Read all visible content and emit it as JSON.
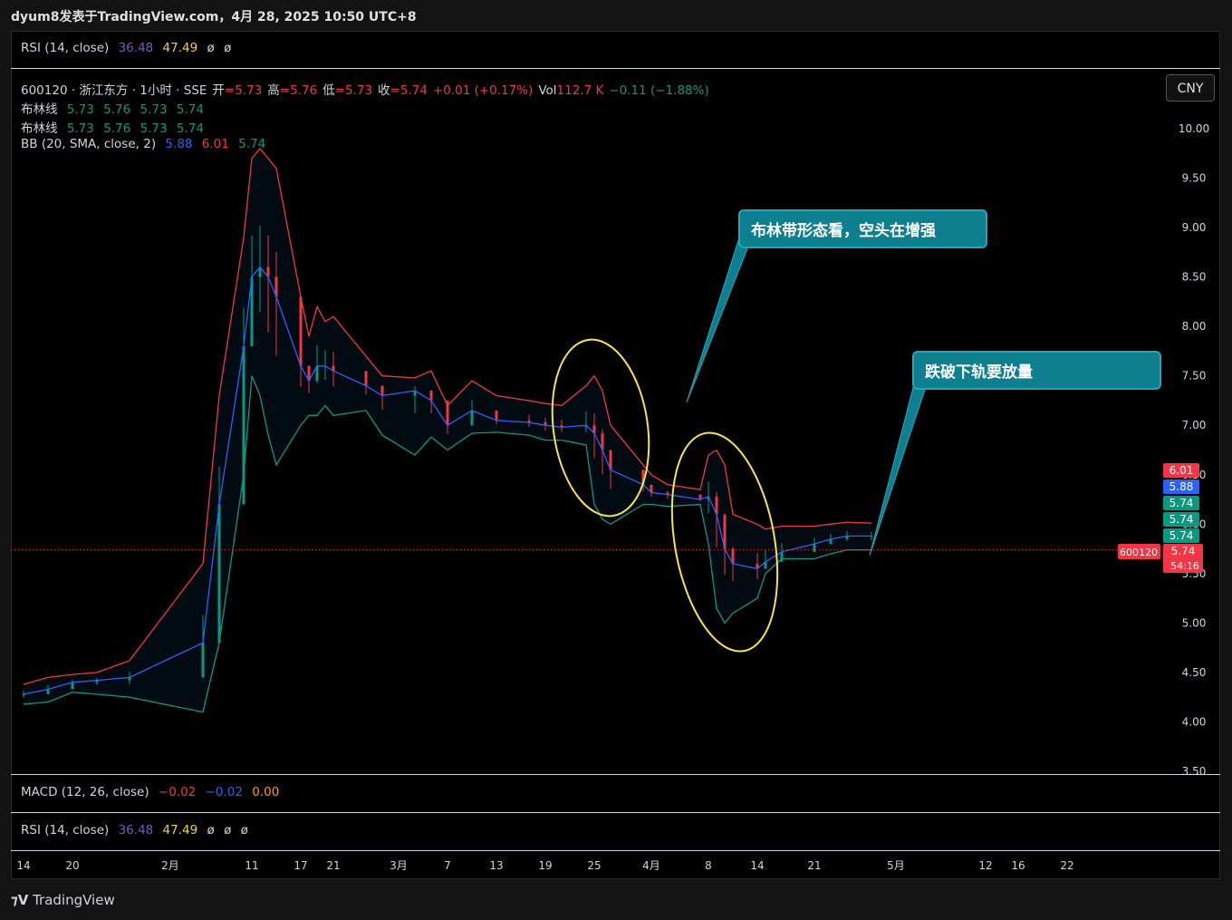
{
  "header": {
    "title": "dyum8发表于TradingView.com，4月 28, 2025 10:50 UTC+8"
  },
  "top_indicator": {
    "name": "RSI (14, close)",
    "v1": "36.48",
    "v2": "47.49",
    "v3": "ø",
    "v4": "ø"
  },
  "main_legend": {
    "symbol_line": "600120 · 浙江东方 · 1小时 · SSE",
    "open_label": "开",
    "open": "=5.73",
    "high_label": "高",
    "high": "=5.76",
    "low_label": "低",
    "low": "=5.73",
    "close_label": "收",
    "close": "=5.74",
    "change": "+0.01 (+0.17%)",
    "vol_label": "Vol",
    "vol": "112.7 K",
    "vol_change": "−0.11 (−1.88%)",
    "boll1_label": "布林线",
    "boll1": [
      "5.73",
      "5.76",
      "5.73",
      "5.74"
    ],
    "boll2_label": "布林线",
    "boll2": [
      "5.73",
      "5.76",
      "5.73",
      "5.74"
    ],
    "bb_label": "BB (20, SMA, close, 2)",
    "bb_basis": "5.88",
    "bb_upper": "6.01",
    "bb_lower": "5.74"
  },
  "currency_button": "CNY",
  "macd": {
    "name": "MACD (12, 26, close)",
    "v1": "−0.02",
    "v2": "−0.02",
    "v3": "0.00"
  },
  "rsi_bottom": {
    "name": "RSI (14, close)",
    "v1": "36.48",
    "v2": "47.49",
    "v3": "ø",
    "v4": "ø",
    "v5": "ø"
  },
  "annotations": {
    "callout1": "布林带形态看，空头在增强",
    "callout2": "跌破下轨要放量"
  },
  "price_tags": {
    "upper": "6.01",
    "basis": "5.88",
    "lower1": "5.74",
    "lower2": "5.74",
    "lower3": "5.74",
    "last": "5.74",
    "countdown": "54:16",
    "symbol": "600120"
  },
  "footer": {
    "logo": "TradingView"
  },
  "colors": {
    "upper": "#f23645",
    "basis": "#2962ff",
    "lower": "#089981",
    "up": "#089981",
    "down": "#f23645",
    "annot": "#f5e44b",
    "callout": "#0e7f8f"
  },
  "chart_data": {
    "type": "line",
    "title": "600120 · 浙江东方 · 1小时 · SSE",
    "ylim": [
      3.5,
      10.0
    ],
    "y_ticks": [
      "10.00",
      "9.50",
      "9.00",
      "8.50",
      "8.00",
      "7.50",
      "7.00",
      "6.50",
      "6.00",
      "5.50",
      "5.00",
      "4.50",
      "4.00",
      "3.50"
    ],
    "x_ticks": [
      "14",
      "20",
      "2月",
      "11",
      "17",
      "21",
      "3月",
      "7",
      "13",
      "19",
      "25",
      "4月",
      "8",
      "14",
      "21",
      "5月",
      "12",
      "16",
      "22"
    ],
    "x": [
      "01-14",
      "01-17",
      "01-20",
      "01-23",
      "01-27",
      "02-05",
      "02-07",
      "02-10",
      "02-11",
      "02-12",
      "02-13",
      "02-14",
      "02-17",
      "02-18",
      "02-19",
      "02-20",
      "02-21",
      "02-25",
      "02-27",
      "03-03",
      "03-05",
      "03-07",
      "03-10",
      "03-13",
      "03-17",
      "03-19",
      "03-21",
      "03-24",
      "03-25",
      "03-26",
      "03-27",
      "03-31",
      "04-01",
      "04-03",
      "04-07",
      "04-08",
      "04-09",
      "04-10",
      "04-11",
      "04-14",
      "04-15",
      "04-17",
      "04-21",
      "04-23",
      "04-25",
      "04-28"
    ],
    "series": [
      {
        "name": "upper",
        "values": [
          4.38,
          4.45,
          4.48,
          4.5,
          4.62,
          5.6,
          7.3,
          8.9,
          9.7,
          9.8,
          9.7,
          9.6,
          8.3,
          7.9,
          8.2,
          8.05,
          8.1,
          7.7,
          7.5,
          7.48,
          7.55,
          7.2,
          7.45,
          7.3,
          7.25,
          7.22,
          7.2,
          7.4,
          7.5,
          7.35,
          7.0,
          6.6,
          6.5,
          6.4,
          6.35,
          6.7,
          6.75,
          6.6,
          6.1,
          6.0,
          5.95,
          5.98,
          5.98,
          6.0,
          6.02,
          6.01
        ]
      },
      {
        "name": "basis",
        "values": [
          4.28,
          4.33,
          4.4,
          4.42,
          4.45,
          4.8,
          6.2,
          7.8,
          8.5,
          8.6,
          8.5,
          8.3,
          7.6,
          7.45,
          7.6,
          7.6,
          7.55,
          7.4,
          7.3,
          7.35,
          7.25,
          7.0,
          7.15,
          7.05,
          7.03,
          7.0,
          6.98,
          7.0,
          6.92,
          6.75,
          6.55,
          6.4,
          6.32,
          6.3,
          6.25,
          6.28,
          6.1,
          5.75,
          5.6,
          5.55,
          5.62,
          5.72,
          5.8,
          5.85,
          5.88,
          5.88
        ]
      },
      {
        "name": "lower",
        "values": [
          4.18,
          4.2,
          4.3,
          4.28,
          4.25,
          4.1,
          4.8,
          6.5,
          7.5,
          7.3,
          6.9,
          6.6,
          7.0,
          7.1,
          7.1,
          7.2,
          7.1,
          7.15,
          6.9,
          6.7,
          6.88,
          6.75,
          6.92,
          6.93,
          6.9,
          6.85,
          6.85,
          6.8,
          6.2,
          6.05,
          6.0,
          6.2,
          6.2,
          6.18,
          6.2,
          5.8,
          5.15,
          5.0,
          5.1,
          5.25,
          5.5,
          5.65,
          5.65,
          5.7,
          5.74,
          5.74
        ]
      }
    ],
    "last_price": 5.74,
    "legend": "top-left",
    "grid": false
  }
}
